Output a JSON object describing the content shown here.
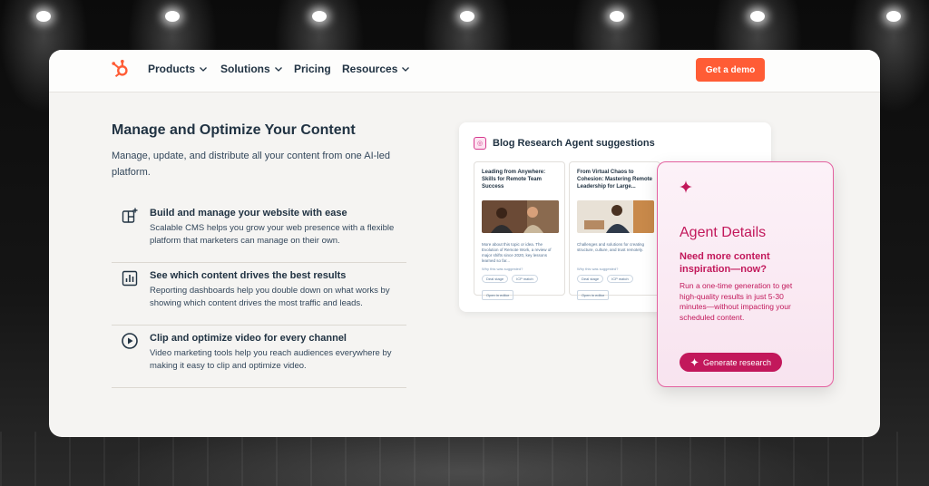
{
  "nav": {
    "items": [
      {
        "label": "Products",
        "has_dropdown": true
      },
      {
        "label": "Solutions",
        "has_dropdown": true
      },
      {
        "label": "Pricing",
        "has_dropdown": false
      },
      {
        "label": "Resources",
        "has_dropdown": true
      }
    ],
    "cta_label": "Get a demo"
  },
  "hero": {
    "title": "Manage and Optimize Your Content",
    "subtitle": "Manage, update, and distribute all your content from one AI-led platform."
  },
  "features": [
    {
      "icon": "layout-plus-icon",
      "title": "Build and manage your website with ease",
      "description": "Scalable CMS helps you grow your web presence with a flexible platform that marketers can manage on their own."
    },
    {
      "icon": "bar-chart-icon",
      "title": "See which content drives the best results",
      "description": "Reporting dashboards help you double down on what works by showing which content drives the most traffic and leads."
    },
    {
      "icon": "play-circle-icon",
      "title": "Clip and optimize video for every channel",
      "description": "Video marketing tools help you reach audiences everywhere by making it easy to clip and optimize video."
    }
  ],
  "research_panel": {
    "title": "Blog Research Agent suggestions",
    "cards": [
      {
        "title": "Leading from Anywhere: Skills for Remote Team Success",
        "description": "More about this topic or idea. The Evolution of Remote Work, a review of major shifts since 2020, key lessons learned so far...",
        "why": "Why this was suggested?",
        "tags": [
          "Deal stage",
          "ICP match"
        ],
        "open_label": "Open in editor"
      },
      {
        "title": "From Virtual Chaos to Cohesion: Mastering Remote Leadership for Large...",
        "description": "Challenges and solutions for creating structure, culture, and trust remotely.",
        "why": "Why this was suggested?",
        "tags": [
          "Deal stage",
          "ICP match"
        ],
        "open_label": "Open in editor"
      }
    ]
  },
  "agent_card": {
    "title": "Agent Details",
    "subtitle": "Need more content inspiration—now?",
    "description": "Run a one-time generation to get high-quality results in just 5-30 minutes—without impacting your scheduled content.",
    "button_label": "Generate research"
  },
  "colors": {
    "brand_orange": "#ff5c35",
    "agent_pink": "#c2185b",
    "navy_text": "#213343"
  }
}
